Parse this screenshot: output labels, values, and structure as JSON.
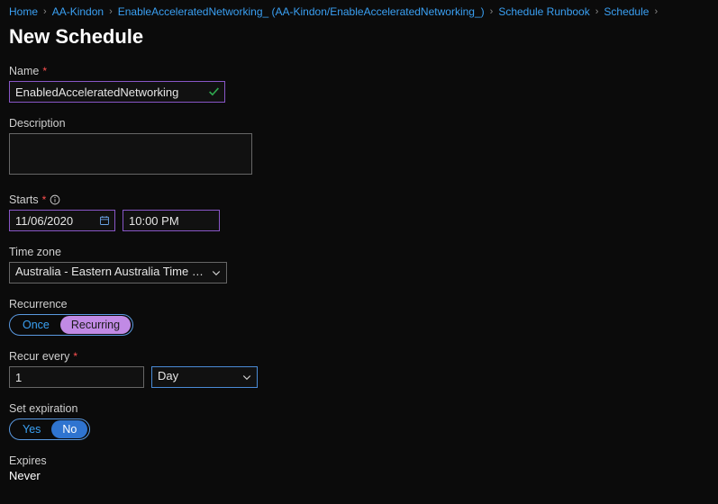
{
  "breadcrumb": {
    "items": [
      {
        "label": "Home"
      },
      {
        "label": "AA-Kindon"
      },
      {
        "label": "EnableAcceleratedNetworking_ (AA-Kindon/EnableAcceleratedNetworking_)"
      },
      {
        "label": "Schedule Runbook"
      },
      {
        "label": "Schedule"
      }
    ]
  },
  "page": {
    "title": "New Schedule"
  },
  "form": {
    "name": {
      "label": "Name",
      "value": "EnabledAcceleratedNetworking"
    },
    "description": {
      "label": "Description",
      "value": ""
    },
    "starts": {
      "label": "Starts",
      "date": "11/06/2020",
      "time": "10:00 PM"
    },
    "timezone": {
      "label": "Time zone",
      "value": "Australia - Eastern Australia Time (Sydn…"
    },
    "recurrence": {
      "label": "Recurrence",
      "options": [
        "Once",
        "Recurring"
      ],
      "selected": "Recurring"
    },
    "recur_every": {
      "label": "Recur every",
      "value": "1",
      "unit": "Day"
    },
    "set_expiration": {
      "label": "Set expiration",
      "options": [
        "Yes",
        "No"
      ],
      "selected": "No"
    },
    "expires": {
      "label": "Expires",
      "value": "Never"
    }
  }
}
